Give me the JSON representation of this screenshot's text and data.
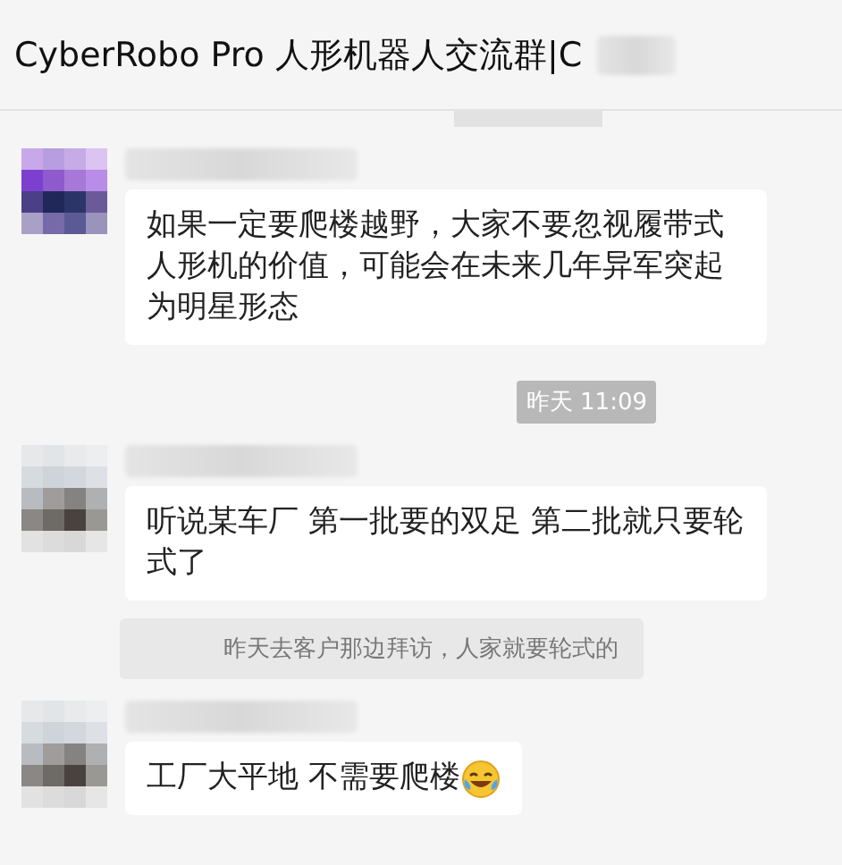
{
  "window": {
    "title": "CyberRobo Pro 人形机器人交流群|C"
  },
  "feed": [
    {
      "kind": "cut_timestamp"
    },
    {
      "kind": "message",
      "text": "如果一定要爬楼越野，大家不要忽视履带式人形机的价值，可能会在未来几年异军突起为明星形态",
      "trailing_icon": false
    },
    {
      "kind": "timestamp",
      "text": "昨天 11:09"
    },
    {
      "kind": "message",
      "text": "听说某车厂 第一批要的双足 第二批就只要轮式了",
      "trailing_icon": false
    },
    {
      "kind": "quote",
      "text": "昨天去客户那边拜访，人家就要轮式的"
    },
    {
      "kind": "message",
      "text": "工厂大平地 不需要爬楼",
      "trailing_icon": true
    }
  ]
}
